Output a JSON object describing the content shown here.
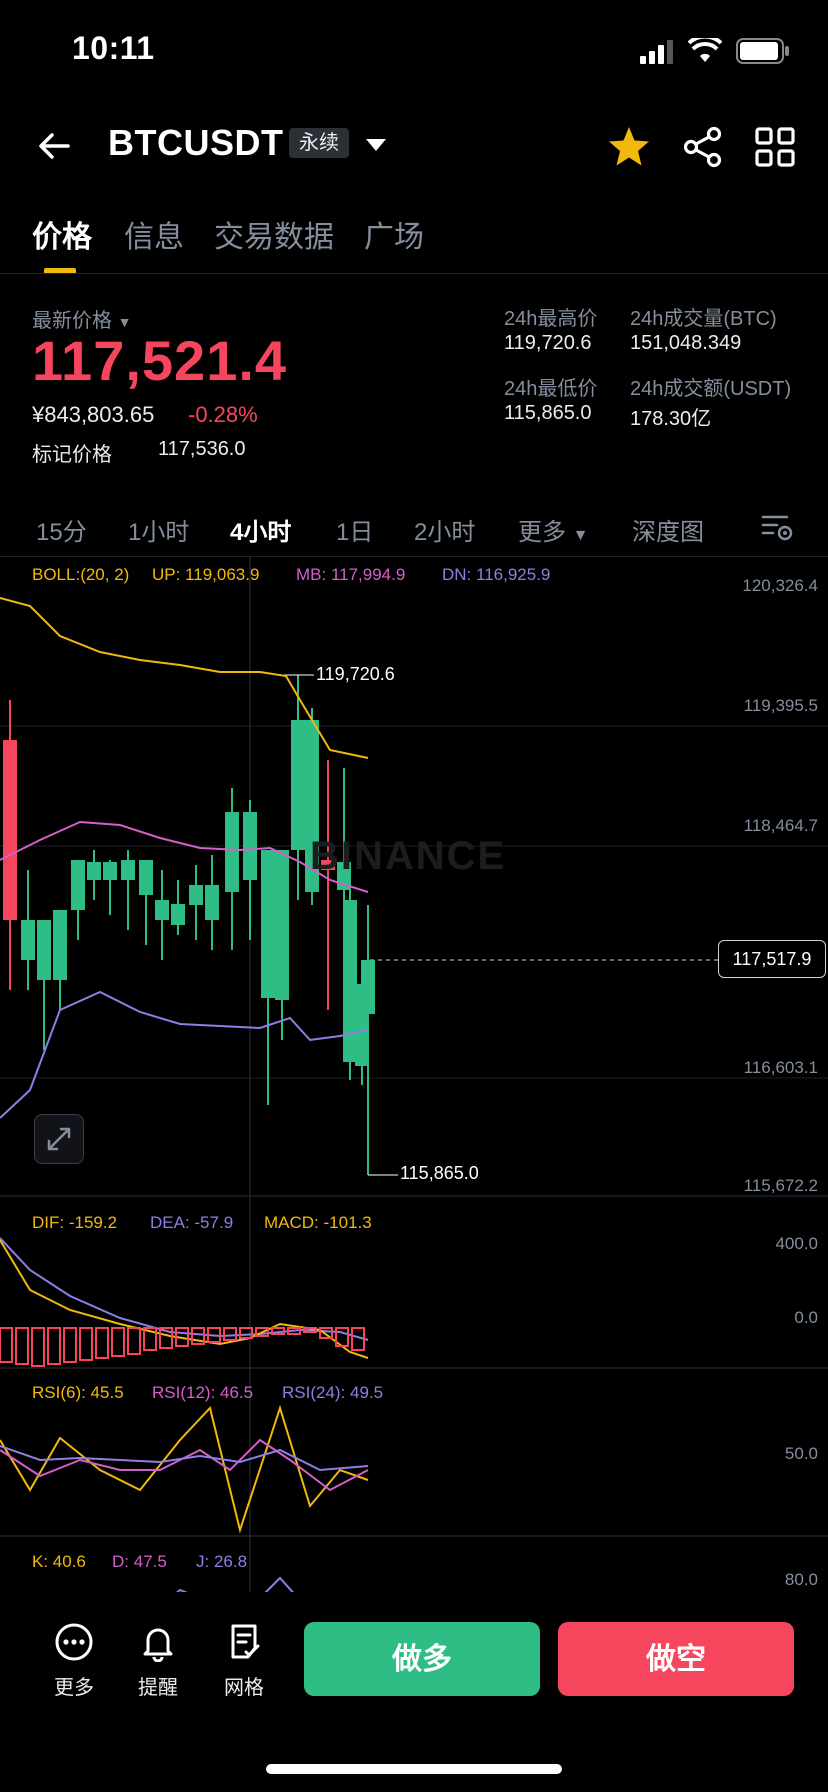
{
  "status": {
    "time": "10:11"
  },
  "header": {
    "pair": "BTCUSDT",
    "contract": "永续"
  },
  "tabs": [
    "价格",
    "信息",
    "交易数据",
    "广场"
  ],
  "price": {
    "last_label": "最新价格",
    "last": "117,521.4",
    "cny": "¥843,803.65",
    "change": "-0.28%",
    "mark_label": "标记价格",
    "mark": "117,536.0"
  },
  "stats": {
    "high_label": "24h最高价",
    "high": "119,720.6",
    "low_label": "24h最低价",
    "low": "115,865.0",
    "vol_label": "24h成交量(BTC)",
    "vol": "151,048.349",
    "turnover_label": "24h成交额(USDT)",
    "turnover": "178.30亿"
  },
  "intervals": [
    "15分",
    "1小时",
    "4小时",
    "1日",
    "2小时",
    "更多",
    "深度图"
  ],
  "active_interval": "4小时",
  "indicators": {
    "boll": {
      "label": "BOLL:(20, 2)",
      "up": "UP: 119,063.9",
      "mb": "MB: 117,994.9",
      "dn": "DN: 116,925.9"
    },
    "macd": {
      "dif": "DIF: -159.2",
      "dea": "DEA: -57.9",
      "macd": "MACD: -101.3"
    },
    "rsi": {
      "r6": "RSI(6): 45.5",
      "r12": "RSI(12): 46.5",
      "r24": "RSI(24): 49.5"
    },
    "kdj": {
      "k": "K: 40.6",
      "d": "D: 47.5",
      "j": "J: 26.8"
    }
  },
  "price_axis": [
    "120,326.4",
    "119,395.5",
    "118,464.7",
    "116,603.1",
    "115,672.2"
  ],
  "current_price_tag": "117,517.9",
  "high_marker": "119,720.6",
  "low_marker": "115,865.0",
  "macd_axis": [
    "400.0",
    "0.0"
  ],
  "rsi_axis": [
    "50.0"
  ],
  "kdj_axis": [
    "80.0"
  ],
  "watermark": "BINANCE",
  "colors": {
    "up": "#2ebd85",
    "down": "#f6465d",
    "accent": "#f0b90b",
    "boll_up": "#f0b90b",
    "boll_mb": "#d55fc9",
    "boll_dn": "#8f7ee3"
  },
  "bottom_bar": {
    "more": "更多",
    "alert": "提醒",
    "grid": "网格",
    "long": "做多",
    "short": "做空"
  }
}
